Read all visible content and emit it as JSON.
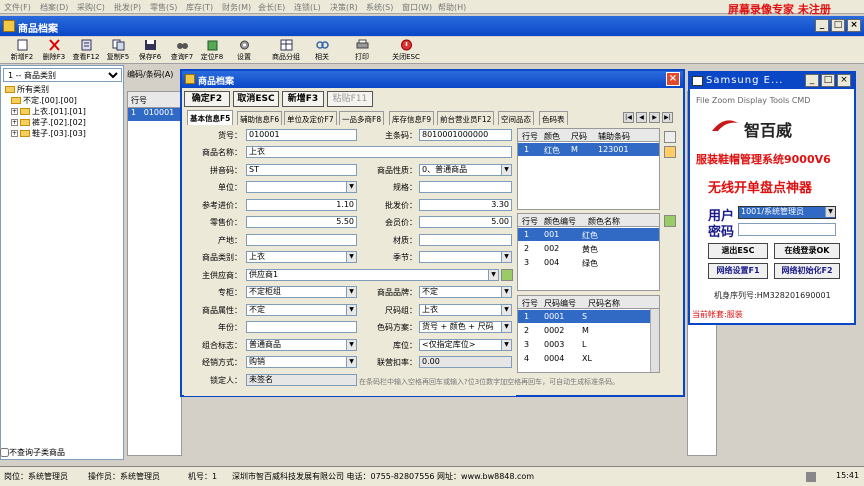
{
  "menubar": {
    "items": [
      "文件(F)",
      "档案(D)",
      "采购(C)",
      "批发(P)",
      "零售(S)",
      "库存(T)",
      "财务(M)",
      "会长(E)",
      "连锁(L)",
      "决策(R)",
      "系统(S)",
      "窗口(W)",
      "帮助(H)"
    ],
    "watermark": "屏幕录像专家 未注册"
  },
  "window": {
    "title": "商品档案"
  },
  "toolbar": {
    "new": "新增F2",
    "delete": "删除F3",
    "view": "查看F12",
    "copy": "复制F5",
    "save": "保存F6",
    "query": "查询F7",
    "locate": "定位F8",
    "settings": "设置",
    "group": "商品分组",
    "related": "相关",
    "print": "打印",
    "close": "关闭ESC"
  },
  "left": {
    "category_select": "1 -- 商品类别",
    "tree": [
      "所有类别",
      "不定.[00].[00]",
      "上衣.[01].[01]",
      "裤子.[02].[02]",
      "鞋子.[03].[03]"
    ],
    "subcat_checkbox": "不查询子类商品"
  },
  "background": {
    "search_label": "编码/条码(A)",
    "grid_header": "行号",
    "grid_row_num": "1",
    "grid_row_code": "010001"
  },
  "dialog": {
    "title": "商品档案",
    "btn_ok": "确定F2",
    "btn_cancel": "取消ESC",
    "btn_new": "新增F3",
    "btn_paste": "粘贴F11",
    "tabs": [
      "基本信息F5",
      "辅助信息F6",
      "单位及定价F7",
      "一品多商F8",
      "库存信息F9",
      "前台营业员F12",
      "空间品态",
      "色码表"
    ],
    "fields": {
      "code_label": "货号：",
      "code": "010001",
      "barcode_label": "主条码：",
      "barcode": "8010001000000",
      "name_label": "商品名称：",
      "name": "上衣",
      "pinyin_label": "拼音码：",
      "pinyin": "ST",
      "nature_label": "商品性质：",
      "nature": "0、普通商品",
      "unit_label": "单位：",
      "unit": "",
      "spec_label": "规格：",
      "spec": "",
      "ref_price_label": "参考进价：",
      "ref_price": "1.10",
      "wholesale_label": "批发价：",
      "wholesale": "3.30",
      "retail_label": "零售价：",
      "retail": "5.50",
      "member_label": "会员价：",
      "member": "5.00",
      "origin_label": "产地：",
      "origin": "",
      "material_label": "材质：",
      "material": "",
      "category_label": "商品类别：",
      "category": "上衣",
      "season_label": "季节：",
      "season": "",
      "supplier_label": "主供应商：",
      "supplier": "供应商1",
      "counter_label": "专柜：",
      "counter": "不定柜组",
      "brand_label": "商品品牌：",
      "brand": "不定",
      "attr_label": "商品属性：",
      "attr": "不定",
      "size_group_label": "尺码组：",
      "size_group": "上衣",
      "year_label": "年份：",
      "year": "",
      "color_scheme_label": "色码方案：",
      "color_scheme": "货号 + 颜色 + 尺码",
      "combo_label": "组合标志：",
      "combo": "普通商品",
      "warehouse_label": "库位：",
      "warehouse": "<仅指定库位>",
      "operation_label": "经销方式：",
      "operation": "购销",
      "deduct_label": "联营扣率：",
      "deduct": "0.00",
      "locker_label": "锁定人：",
      "locker": "未签名"
    },
    "hint": "在条码栏中输入空格再回车或输入?位3位数字加空格再回车，可自动生成标准条码。",
    "barcode_grid": {
      "headers": [
        "行号",
        "颜色",
        "尺码",
        "辅助条码"
      ],
      "rows": [
        {
          "num": "1",
          "color": "红色",
          "size": "M",
          "code": "123001"
        }
      ]
    },
    "color_grid": {
      "headers": [
        "行号",
        "颜色编号",
        "颜色名称"
      ],
      "rows": [
        {
          "num": "1",
          "code": "001",
          "name": "红色"
        },
        {
          "num": "2",
          "code": "002",
          "name": "黄色"
        },
        {
          "num": "3",
          "code": "004",
          "name": "绿色"
        }
      ]
    },
    "size_grid": {
      "headers": [
        "行号",
        "尺码编号",
        "尺码名称"
      ],
      "rows": [
        {
          "num": "1",
          "code": "0001",
          "name": "S"
        },
        {
          "num": "2",
          "code": "0002",
          "name": "M"
        },
        {
          "num": "3",
          "code": "0003",
          "name": "L"
        },
        {
          "num": "4",
          "code": "0004",
          "name": "XL"
        }
      ]
    }
  },
  "samsung": {
    "title": "Samsung E...",
    "menu": "File  Zoom  Display  Tools  CMD",
    "brand": "智百威",
    "slogan1": "服装鞋帽管理系统9000V6",
    "slogan2": "无线开单盘点神器",
    "user_label": "用户",
    "user_value": "1001/系统管理员",
    "pwd_label": "密码",
    "btn_exit": "退出ESC",
    "btn_login": "在线登录OK",
    "btn_netset": "网络设置F1",
    "btn_netinit": "网络初始化F2",
    "machine": "机身序列号:HM328201690001",
    "account": "当前帐套:服装"
  },
  "status": {
    "position": "岗位：系统管理员",
    "operator": "操作员：系统管理员",
    "machine": "机号：1",
    "company": "深圳市智百威科技发展有限公司 电话：0755-82807556 网址：www.bw8848.com",
    "clock": "15:41"
  },
  "colors": {
    "titlebar": "#0a47c7",
    "selection": "#316ac5",
    "red": "#e01010"
  }
}
